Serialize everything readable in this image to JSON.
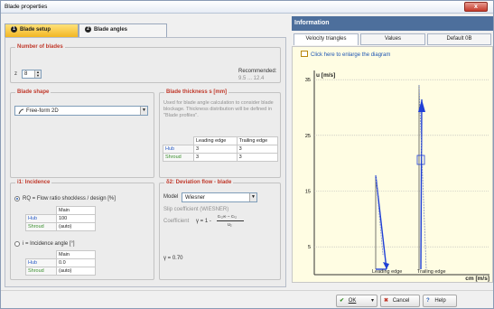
{
  "window": {
    "title": "Blade properties",
    "close_glyph": "x"
  },
  "tabs": [
    {
      "num": "1",
      "label": "Blade setup"
    },
    {
      "num": "2",
      "label": "Blade angles"
    }
  ],
  "blades": {
    "title": "Number of blades",
    "z_label": "z",
    "z_value": "8",
    "recommended_label": "Recommended:",
    "recommended_value": "9.5 ... 12.4"
  },
  "shape": {
    "title": "Blade shape",
    "value": "Free-form 2D"
  },
  "thickness": {
    "title": "Blade thickness s [mm]",
    "desc": "Used for blade angle calculation to consider blade blockage. Thickness distribution will be defined in \"Blade profiles\".",
    "cols": [
      "Leading edge",
      "Trailing edge"
    ],
    "rows": [
      {
        "name": "Hub",
        "le": "3",
        "te": "3"
      },
      {
        "name": "Shroud",
        "le": "3",
        "te": "3"
      }
    ]
  },
  "incidence": {
    "title": "i1: Incidence",
    "option1": "RQ = Flow ratio shockless / design [%]",
    "col": "Main",
    "rows1": [
      {
        "name": "Hub",
        "val": "100"
      },
      {
        "name": "Shroud",
        "val": "(auto)"
      }
    ],
    "option2": "i = Incidence angle [°]",
    "rows2": [
      {
        "name": "Hub",
        "val": "0.0"
      },
      {
        "name": "Shroud",
        "val": "(auto)"
      }
    ]
  },
  "deviation": {
    "title": "δ2: Deviation flow - blade",
    "model_label": "Model",
    "model_value": "Wiesner",
    "slip_label": "Slip coefficient (WIESNER)",
    "coef_label": "Coefficient",
    "formula_left": "γ = 1 -",
    "formula_num": "cₜ₂∞ − cₜ₂",
    "formula_den": "u₂",
    "gamma": "γ = 0.70"
  },
  "info": {
    "header": "Information",
    "tabs": [
      "Velocity triangles",
      "Values",
      "Default 0B"
    ],
    "enlarge": "Click here to enlarge the diagram"
  },
  "chart_data": {
    "type": "line",
    "ylabel": "u [m/s]",
    "xlabel": "cm [m/s]",
    "yticks": [
      5,
      15,
      25,
      35
    ],
    "ylim": [
      0,
      36
    ],
    "labels": [
      "Leading edge",
      "Trailing edge"
    ]
  },
  "buttons": {
    "ok": "OK",
    "cancel": "Cancel",
    "help": "Help"
  },
  "colors": {
    "accent": "#f2b624",
    "info_header": "#4d6f9c",
    "group_title": "#c0392b"
  }
}
